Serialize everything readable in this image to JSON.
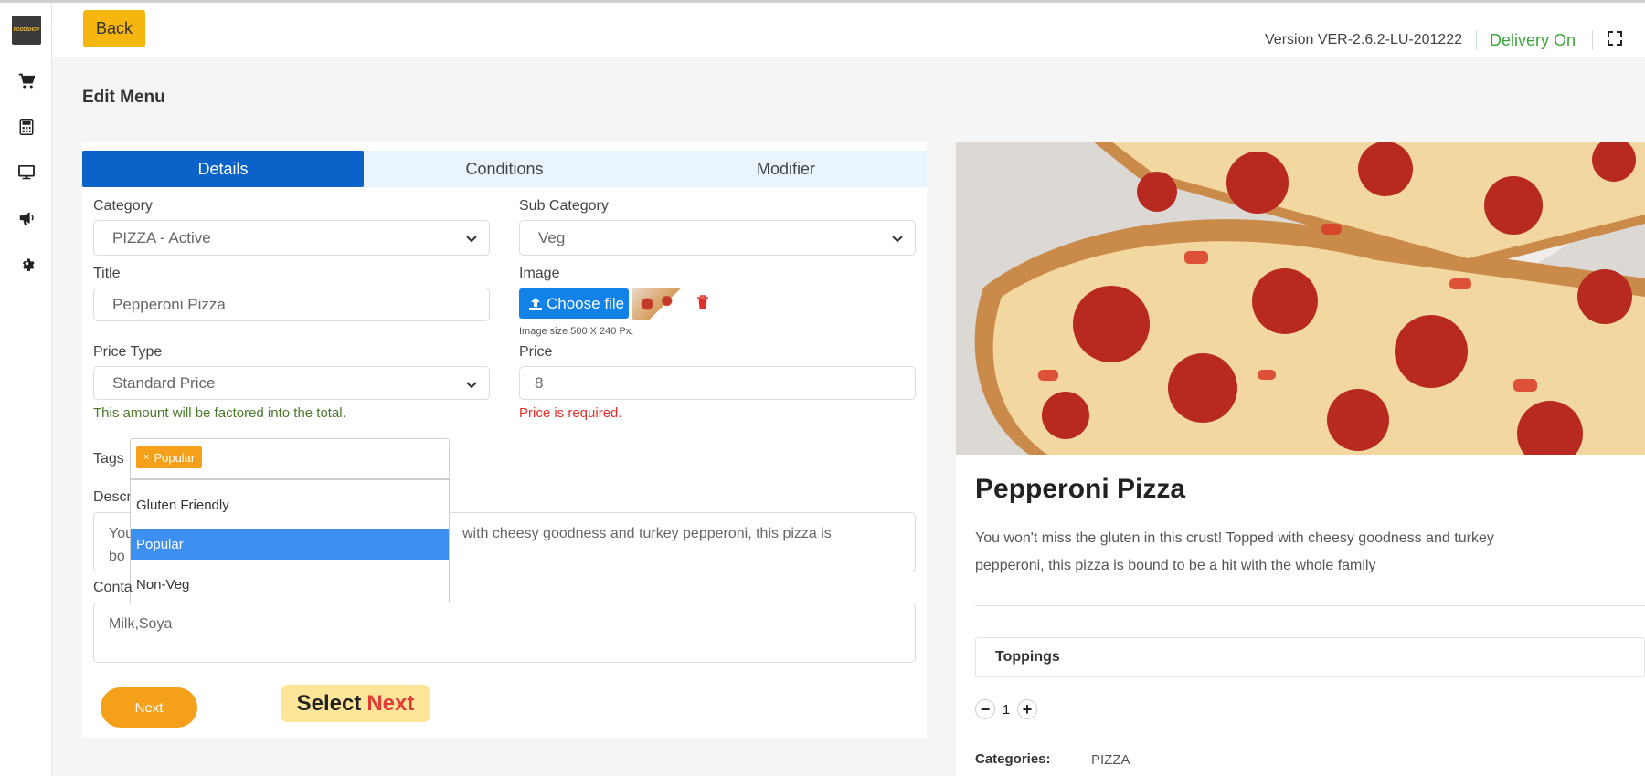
{
  "app": {
    "logo_text": "FOODSHOP"
  },
  "header": {
    "back_label": "Back",
    "version": "Version VER-2.6.2-LU-201222",
    "delivery_status": "Delivery On"
  },
  "sidebar": {
    "items": [
      {
        "icon": "cart-icon"
      },
      {
        "icon": "calculator-icon"
      },
      {
        "icon": "monitor-icon"
      },
      {
        "icon": "megaphone-icon"
      },
      {
        "icon": "gear-icon"
      }
    ]
  },
  "page": {
    "title": "Edit Menu"
  },
  "tabs": [
    {
      "label": "Details",
      "active": true
    },
    {
      "label": "Conditions",
      "active": false
    },
    {
      "label": "Modifier",
      "active": false
    }
  ],
  "form": {
    "category": {
      "label": "Category",
      "value": "PIZZA - Active"
    },
    "sub_category": {
      "label": "Sub Category",
      "value": "Veg"
    },
    "title": {
      "label": "Title",
      "value": "Pepperoni Pizza"
    },
    "image": {
      "label": "Image",
      "button": "Choose file",
      "hint": "Image size 500 X 240 Px."
    },
    "price_type": {
      "label": "Price Type",
      "value": "Standard Price",
      "hint": "This amount will be factored into the total."
    },
    "price": {
      "label": "Price",
      "value": "8",
      "error": "Price is required."
    },
    "tags": {
      "label": "Tags",
      "selected": "Popular",
      "options": [
        "Gluten Friendly",
        "Popular",
        "Non-Veg"
      ]
    },
    "description": {
      "label_visible": "Descr",
      "value_left": "You",
      "value_left2": "bo",
      "value_right": "with cheesy goodness and turkey pepperoni, this pizza is"
    },
    "contains": {
      "label_visible": "Conta",
      "value": "Milk,Soya"
    },
    "next_label": "Next"
  },
  "callout": {
    "prefix": "Select",
    "highlight": "Next"
  },
  "preview": {
    "title": "Pepperoni Pizza",
    "description": "You won't miss the gluten in this crust! Topped with cheesy goodness and turkey pepperoni, this pizza is bound to be a hit with the whole family",
    "toppings_label": "Toppings",
    "quantity": "1",
    "categories_label": "Categories:",
    "categories_value": "PIZZA"
  },
  "colors": {
    "primary_blue": "#0b63c9",
    "accent_orange": "#f5a01a",
    "back_yellow": "#f5b60f",
    "delivery_green": "#3ca53c",
    "error_red": "#e0302a"
  }
}
